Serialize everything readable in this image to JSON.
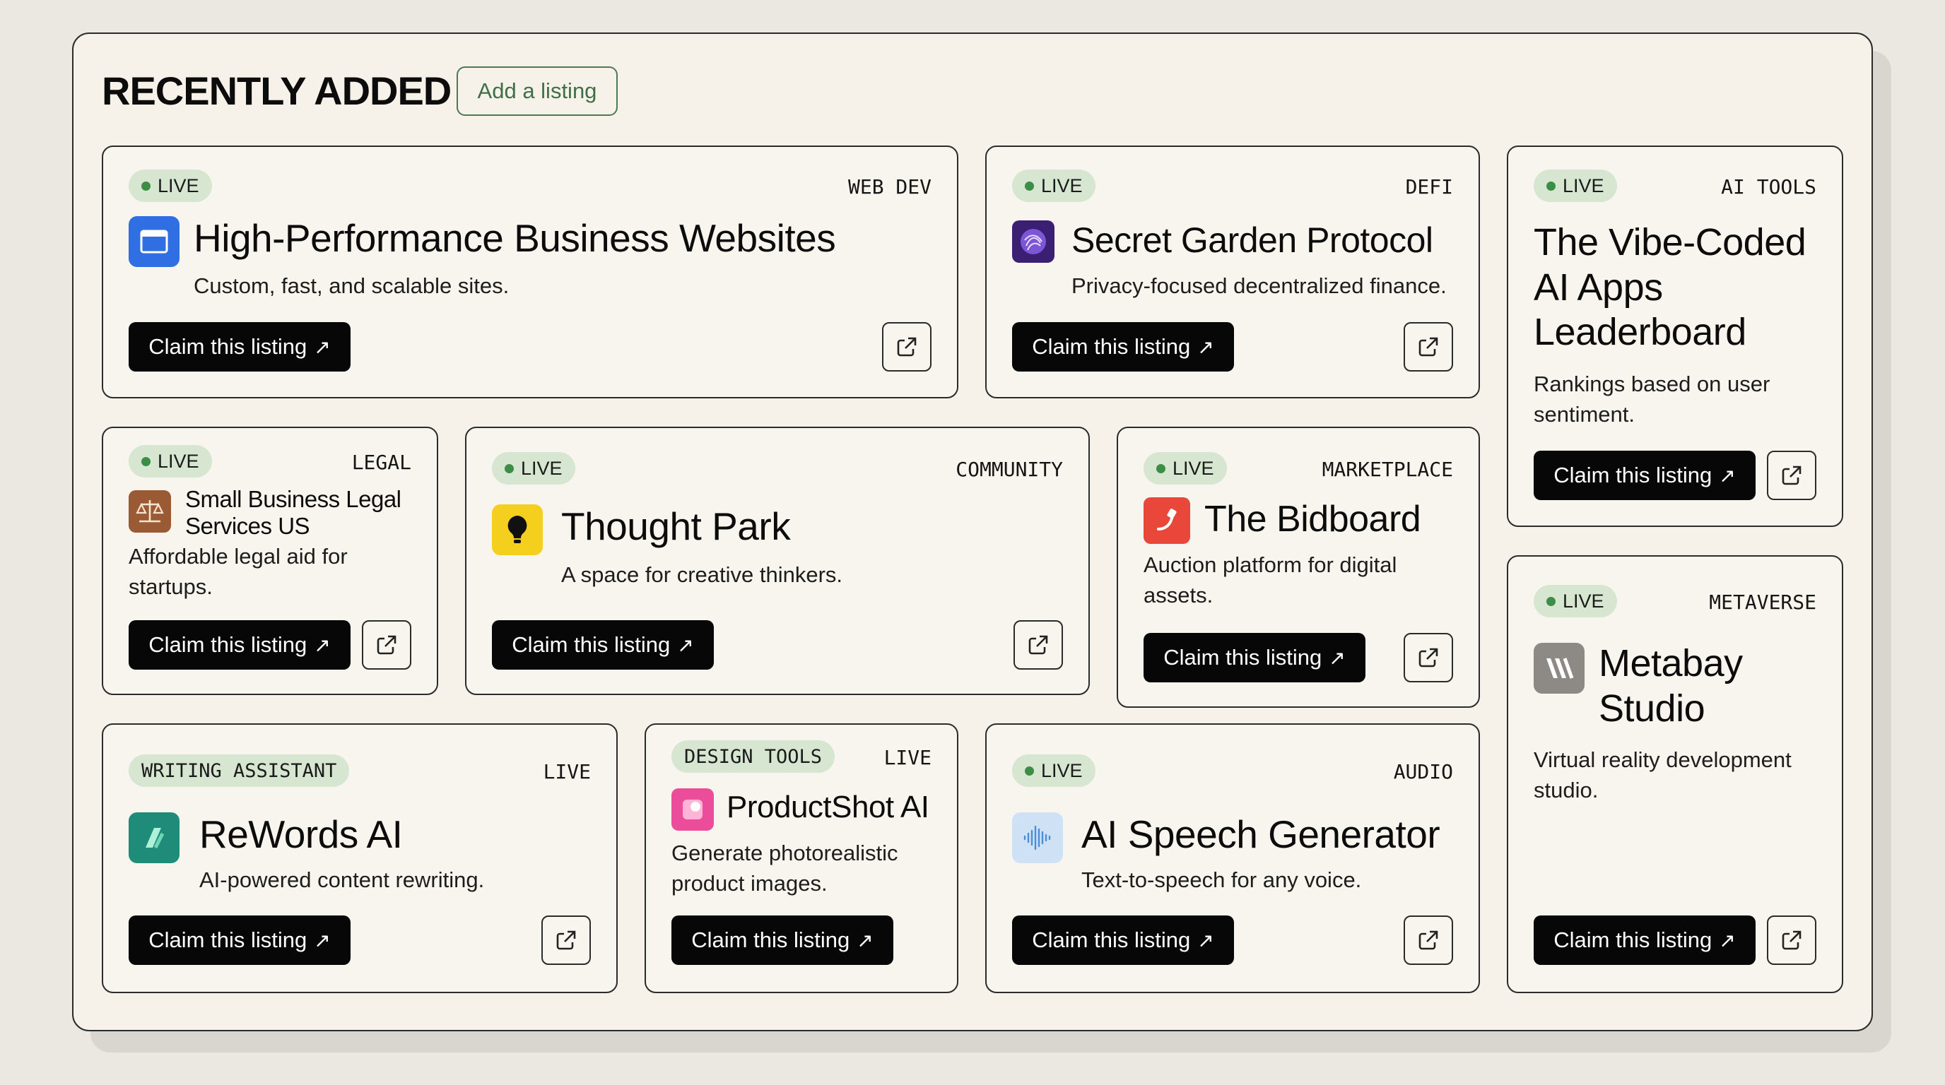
{
  "section": {
    "title": "RECENTLY ADDED",
    "add_label": "Add a listing"
  },
  "claim_label": "Claim this listing",
  "claim_arrow": "↗",
  "cards": [
    {
      "status": "LIVE",
      "category": "WEB DEV",
      "icon": "browser-window-icon",
      "icon_color": "#2f6fe3",
      "title": "High-Performance Business Websites",
      "description": "Custom, fast, and scalable sites."
    },
    {
      "status": "LIVE",
      "category": "DEFI",
      "icon": "swirl-orb-icon",
      "icon_color": "#4b2a8c",
      "title": "Secret Garden Protocol",
      "description": "Privacy-focused decentralized finance."
    },
    {
      "status": "LIVE",
      "category": "AI TOOLS",
      "icon": "",
      "title": "The Vibe-Coded AI Apps Leaderboard",
      "description": "Rankings based on user sentiment."
    },
    {
      "status": "LIVE",
      "category": "LEGAL",
      "icon": "scales-icon",
      "icon_color": "#9a5a34",
      "title": "Small Business Legal Services US",
      "description": "Affordable legal aid for startups."
    },
    {
      "status": "LIVE",
      "category": "COMMUNITY",
      "icon": "lightbulb-icon",
      "icon_color": "#f5cf1e",
      "title": "Thought Park",
      "description": "A space for creative thinkers."
    },
    {
      "status": "LIVE",
      "category": "MARKETPLACE",
      "icon": "bid-hammer-icon",
      "icon_color": "#e8473a",
      "title": "The Bidboard",
      "description": "Auction platform for digital assets."
    },
    {
      "status": "LIVE",
      "category": "METAVERSE",
      "icon": "metabay-logo-icon",
      "icon_color": "#8d8a85",
      "title": "Metabay Studio",
      "description": "Virtual reality development studio."
    },
    {
      "status": "LIVE",
      "category": "WRITING ASSISTANT",
      "icon": "quill-icon",
      "icon_color": "#1f8c7a",
      "title": "ReWords AI",
      "description": "AI-powered content rewriting."
    },
    {
      "status": "LIVE",
      "category": "DESIGN TOOLS",
      "icon": "productshot-icon",
      "icon_color": "#ec4d9a",
      "title": "ProductShot AI",
      "description": "Generate photorealistic product images."
    },
    {
      "status": "LIVE",
      "category": "AUDIO",
      "icon": "soundwave-icon",
      "icon_color": "#cfe2f5",
      "title": "AI Speech Generator",
      "description": "Text-to-speech for any voice."
    }
  ]
}
